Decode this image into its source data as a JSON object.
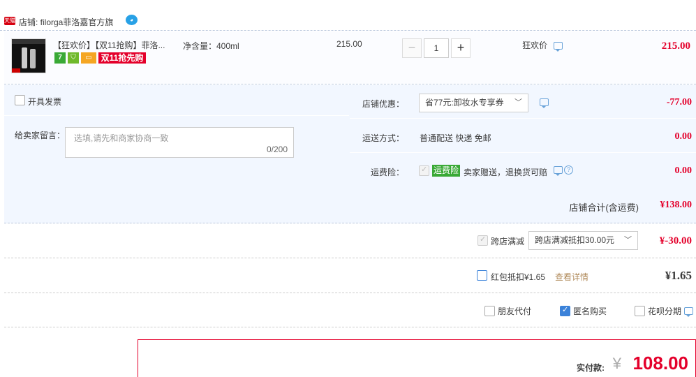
{
  "shop": {
    "logo_text": "天猫",
    "name": "店铺: filorga菲洛嘉官方旗",
    "chat_icon": "wangwang-icon"
  },
  "item": {
    "title": "【狂欢价】【双11抢购】菲洛...",
    "badges": {
      "seven": "7",
      "double11": "双11抢先购"
    },
    "spec": "净含量：400ml",
    "unit_price": "215.00",
    "quantity": "1",
    "minus_label": "−",
    "plus_label": "+",
    "promo_label": "狂欢价",
    "total": "215.00"
  },
  "invoice": {
    "label": "开具发票"
  },
  "message": {
    "label": "给卖家留言：",
    "placeholder": "选填,请先和商家协商一致",
    "count": "0/200"
  },
  "shop_coupon": {
    "label": "店铺优惠：",
    "selected": "省77元:卸妆水专享券",
    "amount": "-77.00"
  },
  "shipping": {
    "label": "运送方式：",
    "value": "普通配送 快递 免邮",
    "amount": "0.00"
  },
  "insurance": {
    "label": "运费险：",
    "tag": "运费险",
    "text": "卖家赠送，退换货可赔",
    "amount": "0.00"
  },
  "shop_total": {
    "label": "店铺合计(含运费)",
    "value": "¥138.00"
  },
  "cross_store": {
    "label": "跨店满减",
    "selected": "跨店满减抵扣30.00元",
    "amount": "¥-30.00"
  },
  "red_packet": {
    "label": "红包抵扣¥1.65",
    "link": "查看详情",
    "amount": "¥1.65"
  },
  "pay_options": {
    "friend": "朋友代付",
    "anonymous": "匿名购买",
    "huabei": "花呗分期"
  },
  "final": {
    "label": "实付款:",
    "currency": "¥",
    "value": "108.00"
  },
  "colors": {
    "accent_red": "#e4002b",
    "panel_bg": "#f2f7ff",
    "tag_green": "#39a936",
    "link_blue": "#3b82d9"
  }
}
